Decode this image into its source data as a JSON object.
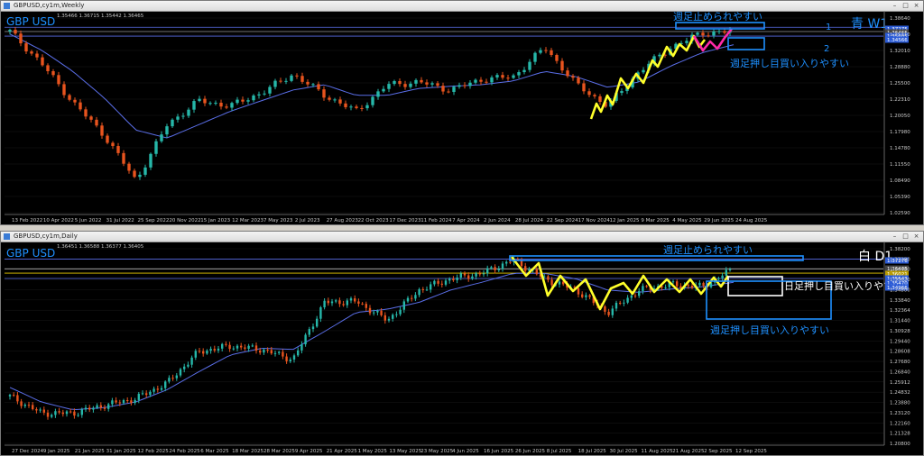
{
  "colors": {
    "bg": "#000000",
    "bull": "#26b7a9",
    "bear": "#e8541e",
    "ma": "#5a6ee8",
    "zigzag_yellow": "#ffff2a",
    "zigzag_pink": "#ff2aa8",
    "annot_blue": "#1e90ff",
    "annot_white": "#ffffff",
    "grid": "#1a1a1a",
    "axis_text": "#c8c8c8"
  },
  "weekly": {
    "window_title": "GBPUSD,cy1m,Weekly",
    "ohlc_text": "1.35466 1.36715 1.35442 1.36465",
    "symbol_label": "GBP USD",
    "tag_label": "青 W1",
    "num1": "1",
    "num2": "2",
    "annotation_top": "週足止められやすい",
    "annotation_bottom": "週足押し目買い入りやすい",
    "price_ticks": [
      "1.38640",
      "1.35310",
      "1.32010",
      "1.28880",
      "1.25500",
      "1.22310",
      "1.20050",
      "1.17980",
      "1.14780",
      "1.11550",
      "1.08490",
      "1.05390",
      "1.02590"
    ],
    "price_tags": [
      "1.37275",
      "1.36465",
      "1.35605",
      "1.34566"
    ],
    "time_labels": [
      "13 Feb 2022",
      "10 Apr 2022",
      "5 Jun 2022",
      "31 Jul 2022",
      "25 Sep 2022",
      "20 Nov 2022",
      "15 Jan 2023",
      "12 Mar 2023",
      "7 May 2023",
      "2 Jul 2023",
      "27 Aug 2023",
      "22 Oct 2023",
      "17 Dec 2023",
      "11 Feb 2024",
      "7 Apr 2024",
      "2 Jun 2024",
      "28 Jul 2024",
      "22 Sep 2024",
      "17 Nov 2024",
      "12 Jan 2025",
      "9 Mar 2025",
      "4 May 2025",
      "29 Jun 2025",
      "24 Aug 2025"
    ]
  },
  "daily": {
    "window_title": "GBPUSD,cy1m,Daily",
    "ohlc_text": "1.36451 1.36588 1.36377 1.36405",
    "symbol_label": "GBP USD",
    "tag_label": "白 D1",
    "annotation_top": "週足止められやすい",
    "annotation_right": "日足押し目買い入りやすい",
    "annotation_bottom": "週足押し目買い入りやすい",
    "price_ticks": [
      "1.38200",
      "1.37280",
      "1.36480",
      "1.35620",
      "1.34800",
      "1.33840",
      "1.32364",
      "1.31440",
      "1.30928",
      "1.29440",
      "1.28608",
      "1.27680",
      "1.26840",
      "1.25912",
      "1.24832",
      "1.23880",
      "1.23120",
      "1.22160",
      "1.21328",
      "1.20800"
    ],
    "price_tags": [
      "1.37276",
      "1.36405",
      "1.36021",
      "1.35543",
      "1.35470",
      "1.34966"
    ],
    "time_labels": [
      "27 Dec 2024",
      "9 Jan 2025",
      "21 Jan 2025",
      "31 Jan 2025",
      "12 Feb 2025",
      "24 Feb 2025",
      "6 Mar 2025",
      "18 Mar 2025",
      "28 Mar 2025",
      "9 Apr 2025",
      "21 Apr 2025",
      "1 May 2025",
      "13 May 2025",
      "23 May 2025",
      "4 Jun 2025",
      "16 Jun 2025",
      "26 Jun 2025",
      "8 Jul 2025",
      "18 Jul 2025",
      "30 Jul 2025",
      "11 Aug 2025",
      "21 Aug 2025",
      "2 Sep 2025",
      "12 Sep 2025"
    ]
  },
  "chart_data": [
    {
      "type": "candlestick",
      "title": "GBPUSD,cy1m,Weekly",
      "ylim": [
        1.025,
        1.39
      ],
      "series": [
        {
          "name": "close",
          "x": [
            "13 Feb 2022",
            "10 Apr 2022",
            "5 Jun 2022",
            "31 Jul 2022",
            "25 Sep 2022",
            "20 Nov 2022",
            "15 Jan 2023",
            "12 Mar 2023",
            "7 May 2023",
            "2 Jul 2023",
            "27 Aug 2023",
            "22 Oct 2023",
            "17 Dec 2023",
            "11 Feb 2024",
            "7 Apr 2024",
            "2 Jun 2024",
            "28 Jul 2024",
            "22 Sep 2024",
            "17 Nov 2024",
            "12 Jan 2025",
            "9 Mar 2025",
            "4 May 2025",
            "29 Jun 2025",
            "24 Aug 2025"
          ],
          "values": [
            1.365,
            1.305,
            1.232,
            1.17,
            1.085,
            1.19,
            1.235,
            1.225,
            1.25,
            1.285,
            1.245,
            1.215,
            1.265,
            1.27,
            1.255,
            1.275,
            1.28,
            1.335,
            1.265,
            1.225,
            1.29,
            1.335,
            1.362,
            1.365
          ]
        },
        {
          "name": "MA",
          "values": [
            1.36,
            1.33,
            1.29,
            1.24,
            1.18,
            1.165,
            1.19,
            1.215,
            1.235,
            1.255,
            1.265,
            1.245,
            1.245,
            1.258,
            1.262,
            1.265,
            1.272,
            1.29,
            1.28,
            1.26,
            1.27,
            1.3,
            1.325,
            1.34
          ]
        }
      ]
    },
    {
      "type": "candlestick",
      "title": "GBPUSD,cy1m,Daily",
      "ylim": [
        1.208,
        1.382
      ],
      "series": [
        {
          "name": "close",
          "x": [
            "27 Dec 2024",
            "9 Jan 2025",
            "21 Jan 2025",
            "31 Jan 2025",
            "12 Feb 2025",
            "24 Feb 2025",
            "6 Mar 2025",
            "18 Mar 2025",
            "28 Mar 2025",
            "9 Apr 2025",
            "21 Apr 2025",
            "1 May 2025",
            "13 May 2025",
            "23 May 2025",
            "4 Jun 2025",
            "16 Jun 2025",
            "26 Jun 2025",
            "8 Jul 2025",
            "18 Jul 2025",
            "30 Jul 2025",
            "11 Aug 2025",
            "21 Aug 2025",
            "2 Sep 2025",
            "12 Sep 2025"
          ],
          "values": [
            1.25,
            1.235,
            1.235,
            1.242,
            1.248,
            1.262,
            1.29,
            1.295,
            1.292,
            1.283,
            1.334,
            1.335,
            1.318,
            1.345,
            1.355,
            1.36,
            1.372,
            1.355,
            1.345,
            1.325,
            1.345,
            1.35,
            1.348,
            1.364
          ]
        },
        {
          "name": "MA",
          "values": [
            1.258,
            1.245,
            1.238,
            1.24,
            1.245,
            1.256,
            1.272,
            1.287,
            1.293,
            1.292,
            1.308,
            1.325,
            1.328,
            1.334,
            1.345,
            1.352,
            1.36,
            1.36,
            1.355,
            1.345,
            1.343,
            1.346,
            1.348,
            1.352
          ]
        }
      ]
    }
  ]
}
